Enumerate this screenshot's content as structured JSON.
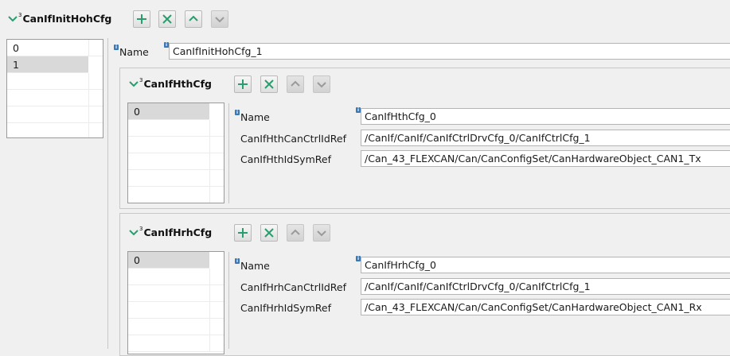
{
  "root": {
    "title_sup": "3",
    "title": "CanIfInitHohCfg",
    "list": [
      "0",
      "1"
    ],
    "selected_index": 1,
    "name_label": "Name",
    "name_value": "CanIfInitHohCfg_1"
  },
  "hth": {
    "title_sup": "3",
    "title": "CanIfHthCfg",
    "list": [
      "0"
    ],
    "name_label": "Name",
    "name_value": "CanIfHthCfg_0",
    "ctrl_label": "CanIfHthCanCtrlIdRef",
    "ctrl_value": "/CanIf/CanIf/CanIfCtrlDrvCfg_0/CanIfCtrlCfg_1",
    "sym_label": "CanIfHthIdSymRef",
    "sym_value": "/Can_43_FLEXCAN/Can/CanConfigSet/CanHardwareObject_CAN1_Tx"
  },
  "hrh": {
    "title_sup": "3",
    "title": "CanIfHrhCfg",
    "list": [
      "0"
    ],
    "name_label": "Name",
    "name_value": "CanIfHrhCfg_0",
    "ctrl_label": "CanIfHrhCanCtrlIdRef",
    "ctrl_value": "/CanIf/CanIf/CanIfCtrlDrvCfg_0/CanIfCtrlCfg_1",
    "sym_label": "CanIfHrhIdSymRef",
    "sym_value": "/Can_43_FLEXCAN/Can/CanConfigSet/CanHardwareObject_CAN1_Rx"
  },
  "icons": {
    "expand": "chevron-down-icon",
    "add": "plus-icon",
    "remove": "x-icon",
    "up": "arrow-up-icon",
    "down": "arrow-down-icon",
    "info": "info-icon"
  },
  "colors": {
    "accent_green": "#2a9d6e",
    "disabled_gray": "#9a9a9a",
    "info_blue": "#3a78b5"
  }
}
